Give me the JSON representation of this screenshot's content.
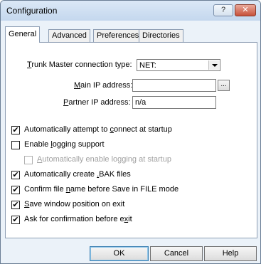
{
  "window": {
    "title": "Configuration",
    "help_button": "?",
    "close_button": "✕"
  },
  "tabs": [
    {
      "label": "General",
      "active": true
    },
    {
      "label": "Advanced",
      "active": false
    },
    {
      "label": "Preferences",
      "active": false
    },
    {
      "label": "Directories",
      "active": false
    }
  ],
  "general": {
    "connection_type_label_pre": "T",
    "connection_type_label_post": "runk Master connection type:",
    "connection_type_value": "NET:",
    "main_ip_label_pre": "M",
    "main_ip_label_post": "ain IP address:",
    "main_ip_value": "",
    "browse_label": "...",
    "partner_ip_label_pre": "P",
    "partner_ip_label_post": "artner IP address:",
    "partner_ip_value": "n/a",
    "checkboxes": [
      {
        "pre": "Automatically attempt to ",
        "key": "c",
        "post": "onnect at startup",
        "checked": true,
        "enabled": true
      },
      {
        "pre": "Enable ",
        "key": "l",
        "post": "ogging support",
        "checked": false,
        "enabled": true
      },
      {
        "pre": "",
        "key": "A",
        "post": "utomatically enable logging at startup",
        "checked": false,
        "enabled": false
      },
      {
        "pre": "Automatically create ",
        "key": ".",
        "post": "BAK files",
        "checked": true,
        "enabled": true
      },
      {
        "pre": "Confirm file ",
        "key": "n",
        "post": "ame before Save in FILE mode",
        "checked": true,
        "enabled": true
      },
      {
        "pre": "",
        "key": "S",
        "post": "ave window position on exit",
        "checked": true,
        "enabled": true
      },
      {
        "pre": "Ask for confirmation before e",
        "key": "x",
        "post": "it",
        "checked": true,
        "enabled": true
      }
    ]
  },
  "buttons": {
    "ok": "OK",
    "cancel": "Cancel",
    "help": "Help"
  },
  "colors": {
    "window_bg": "#ebf2f9",
    "close_red": "#c7503a",
    "default_button_border": "#3c7fb1"
  }
}
